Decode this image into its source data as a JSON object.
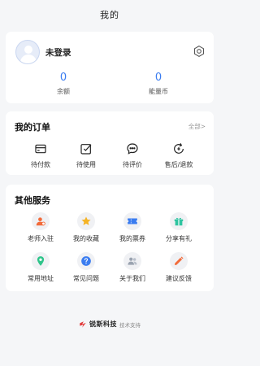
{
  "header": {
    "title": "我的"
  },
  "profile": {
    "username": "未登录",
    "stats": [
      {
        "value": "0",
        "label": "余额"
      },
      {
        "value": "0",
        "label": "能量币"
      }
    ]
  },
  "orders": {
    "title": "我的订单",
    "more": "全部>",
    "items": [
      {
        "label": "待付款",
        "icon": "wallet-icon"
      },
      {
        "label": "待使用",
        "icon": "checkbox-icon"
      },
      {
        "label": "待评价",
        "icon": "chat-bubble-icon"
      },
      {
        "label": "售后/退款",
        "icon": "refund-icon"
      }
    ]
  },
  "services": {
    "title": "其他服务",
    "items": [
      {
        "label": "老师入驻",
        "icon": "teacher-icon",
        "color": "#f26b3a"
      },
      {
        "label": "我的收藏",
        "icon": "star-icon",
        "color": "#f5b324"
      },
      {
        "label": "我的票券",
        "icon": "ticket-icon",
        "color": "#3a7cf0"
      },
      {
        "label": "分享有礼",
        "icon": "gift-icon",
        "color": "#2ec4a0"
      },
      {
        "label": "常用地址",
        "icon": "location-pin-icon",
        "color": "#2ec48a"
      },
      {
        "label": "常见问题",
        "icon": "question-icon",
        "color": "#3a7cf0"
      },
      {
        "label": "关于我们",
        "icon": "people-icon",
        "color": "#9aa3b0"
      },
      {
        "label": "建议反馈",
        "icon": "pencil-icon",
        "color": "#f26b3a"
      }
    ]
  },
  "footer": {
    "brand": "锐斯科技",
    "support": "技术支持"
  },
  "colors": {
    "accent": "#3a7cf0",
    "background": "#f5f6f8"
  }
}
